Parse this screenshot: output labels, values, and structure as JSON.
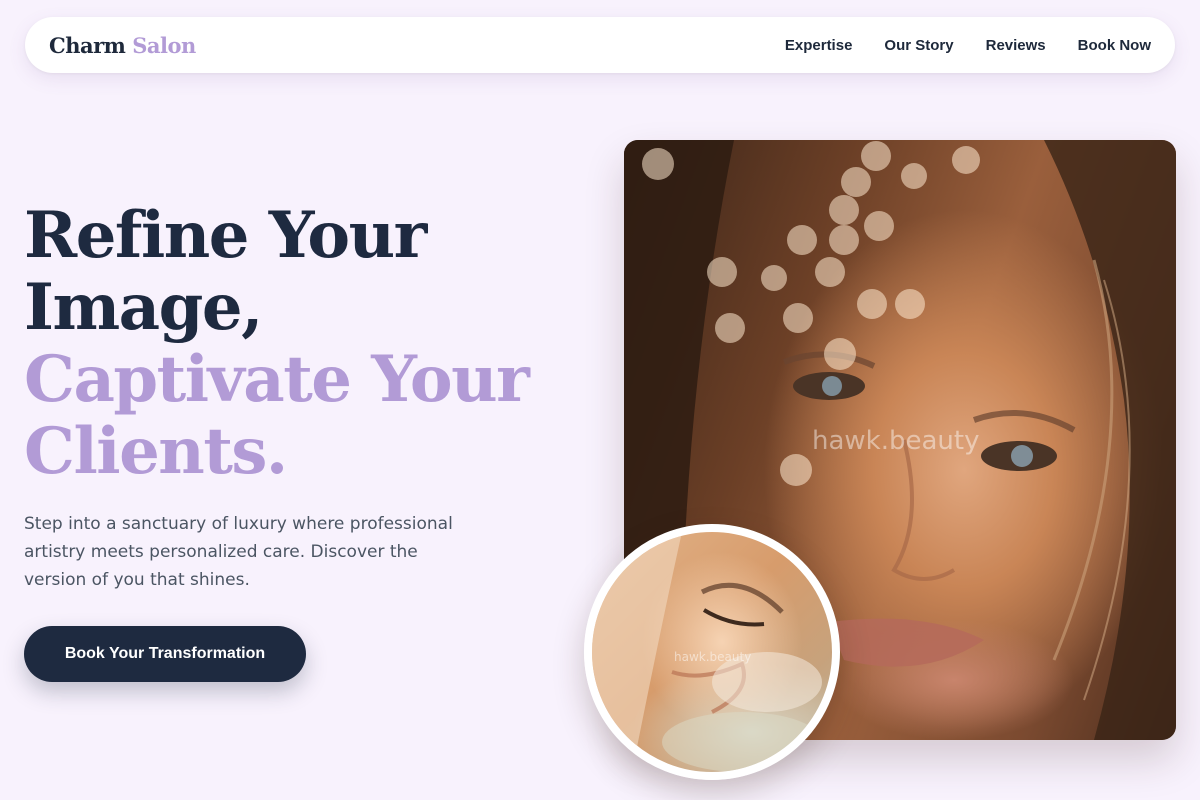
{
  "nav": {
    "logo_first": "Charm",
    "logo_second": "Salon",
    "links": [
      "Expertise",
      "Our Story",
      "Reviews",
      "Book Now"
    ]
  },
  "hero": {
    "headline_line1": "Refine Your",
    "headline_line2": "Image,",
    "headline_accent_line1": "Captivate Your",
    "headline_accent_line2": "Clients.",
    "subtext": "Step into a sanctuary of luxury where professional artistry meets personalized care. Discover the version of you that shines.",
    "cta_label": "Book Your Transformation"
  },
  "images": {
    "main_watermark": "hawk.beauty",
    "inset_watermark": "hawk.beauty"
  },
  "colors": {
    "background": "#f8f2fd",
    "primary_dark": "#1e2a40",
    "accent_lavender": "#b29bd6",
    "body_text": "#4b5563"
  }
}
